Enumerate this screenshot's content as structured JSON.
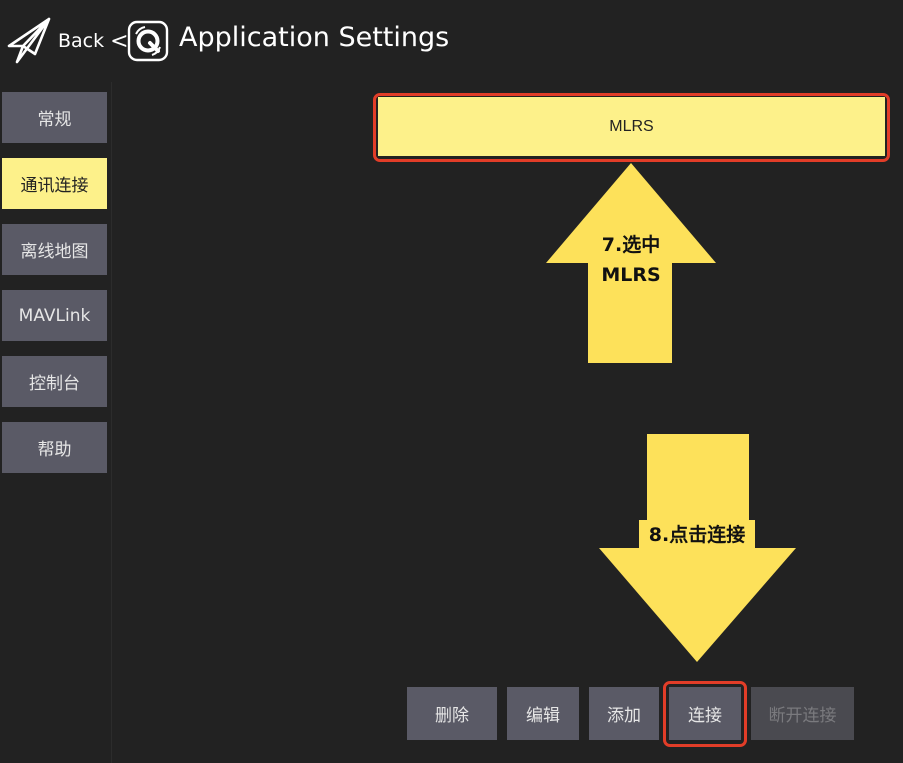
{
  "header": {
    "back_label": "Back",
    "back_separator": "<",
    "title": "Application Settings"
  },
  "sidebar": {
    "items": [
      {
        "label": "常规",
        "active": false
      },
      {
        "label": "通讯连接",
        "active": true
      },
      {
        "label": "离线地图",
        "active": false
      },
      {
        "label": "MAVLink",
        "active": false
      },
      {
        "label": "控制台",
        "active": false
      },
      {
        "label": "帮助",
        "active": false
      }
    ]
  },
  "links": {
    "selected": "MLRS"
  },
  "annotations": {
    "step7_line1": "7.选中",
    "step7_line2": "MLRS",
    "step8": "8.点击连接"
  },
  "buttons": {
    "delete": "删除",
    "edit": "编辑",
    "add": "添加",
    "connect": "连接",
    "disconnect": "断开连接"
  },
  "colors": {
    "background": "#222222",
    "accent": "#fdf18a",
    "button": "#5a5a66",
    "highlight": "#e23d28",
    "arrow": "#fde15a"
  }
}
